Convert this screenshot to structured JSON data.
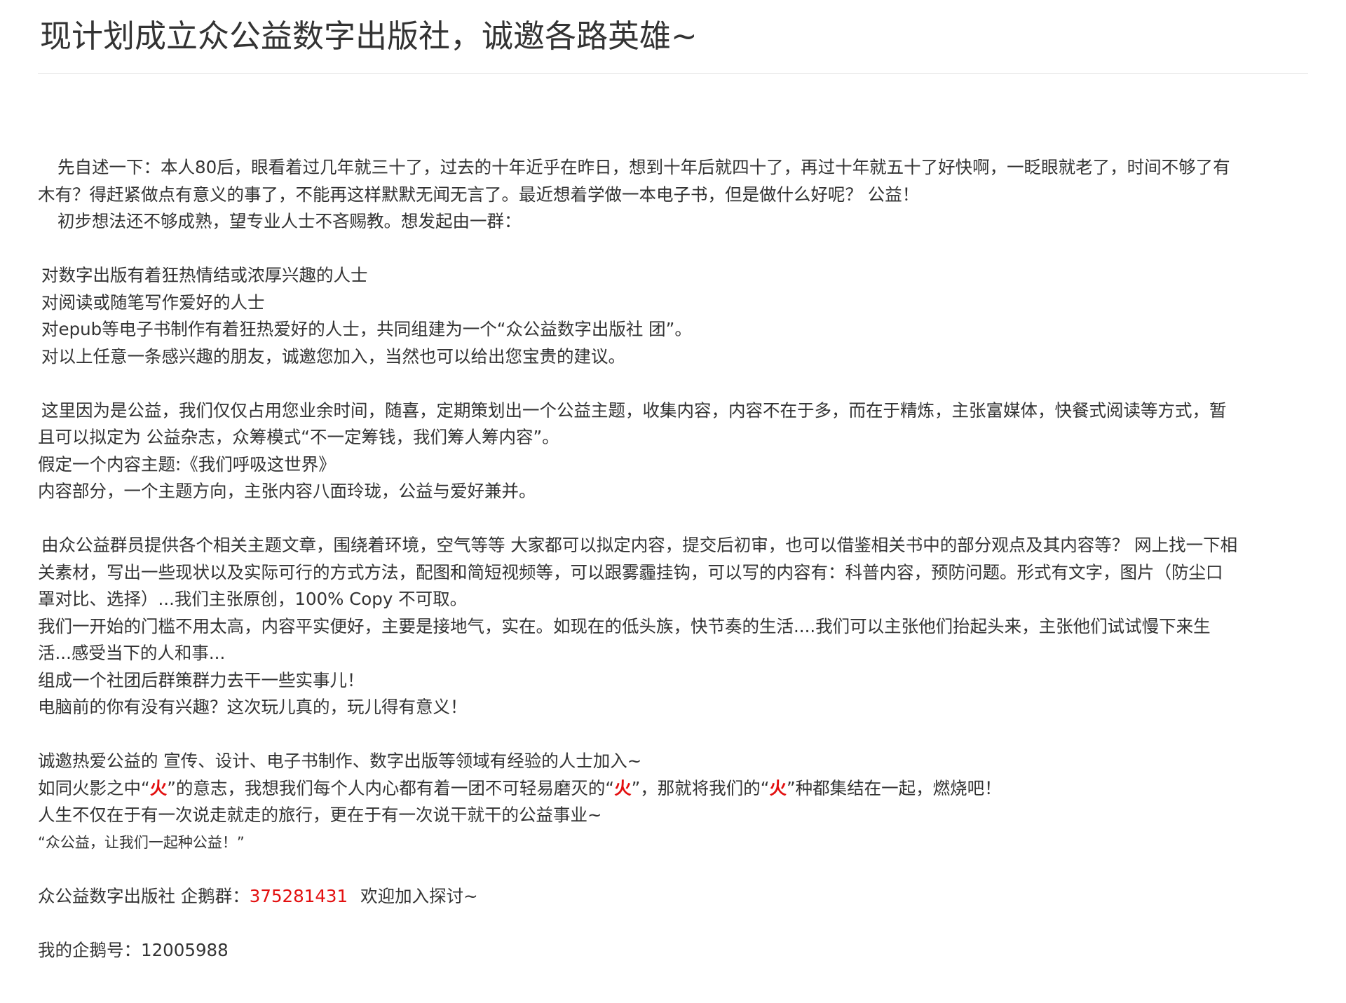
{
  "title": "现计划成立众公益数字出版社，诚邀各路英雄~",
  "intro": {
    "line1": "先自述一下：本人80后，眼看着过几年就三十了，过去的十年近乎在昨日，想到十年后就四十了，再过十年就五十了好快啊，一眨眼就老了，时间不够了有",
    "line2": "木有？得赶紧做点有意义的事了，不能再这样默默无闻无言了。最近想着学做一本电子书，但是做什么好呢？ 公益！",
    "line3": "初步想法还不够成熟，望专业人士不吝赐教。想发起由一群："
  },
  "audience": [
    "对数字出版有着狂热情结或浓厚兴趣的人士",
    "对阅读或随笔写作爱好的人士",
    "对epub等电子书制作有着狂热爱好的人士，共同组建为一个“众公益数字出版社 团”。",
    "对以上任意一条感兴趣的朋友，诚邀您加入，当然也可以给出您宝贵的建议。"
  ],
  "plan": {
    "line1": "这里因为是公益，我们仅仅占用您业余时间，随喜，定期策划出一个公益主题，收集内容，内容不在于多，而在于精炼，主张富媒体，快餐式阅读等方式，暂",
    "line2": "且可以拟定为 公益杂志，众筹模式“不一定筹钱，我们筹人筹内容”。",
    "line3": "假定一个内容主题:《我们呼吸这世界》",
    "line4": "内容部分，一个主题方向，主张内容八面玲珑，公益与爱好兼并。"
  },
  "content": {
    "line1": "由众公益群员提供各个相关主题文章，围绕着环境，空气等等 大家都可以拟定内容，提交后初审，也可以借鉴相关书中的部分观点及其内容等？ 网上找一下相",
    "line2": "关素材，写出一些现状以及实际可行的方式方法，配图和简短视频等，可以跟雾霾挂钩，可以写的内容有：科普内容，预防问题。形式有文字，图片（防尘口",
    "line3": "罩对比、选择）...我们主张原创，100% Copy 不可取。",
    "line4": "我们一开始的门槛不用太高，内容平实便好，主要是接地气，实在。如现在的低头族，快节奏的生活....我们可以主张他们抬起头来，主张他们试试慢下来生",
    "line5": "活...感受当下的人和事...",
    "line6": "组成一个社团后群策群力去干一些实事儿！",
    "line7": "电脑前的你有没有兴趣？这次玩儿真的，玩儿得有意义！"
  },
  "invite": {
    "line1": "诚邀热爱公益的 宣传、设计、电子书制作、数字出版等领域有经验的人士加入~",
    "fire_a": "如同火影之中“",
    "fire_word": "火",
    "fire_b": "”的意志，我想我们每个人内心都有着一团不可轻易磨灭的“",
    "fire_c": "”，那就将我们的“",
    "fire_d": "”种都集结在一起，燃烧吧！",
    "line3": "人生不仅在于有一次说走就走的旅行，更在于有一次说干就干的公益事业~",
    "slogan": "“众公益，让我们一起种公益！”"
  },
  "contact": {
    "group_label": "众公益数字出版社 企鹅群：",
    "group_number": "375281431",
    "group_suffix": "欢迎加入探讨~",
    "qq_label": "我的企鹅号：",
    "qq_number": "12005988"
  },
  "colors": {
    "text": "#333333",
    "accent_red": "#e30f0f",
    "divider": "#e5e5e5"
  }
}
